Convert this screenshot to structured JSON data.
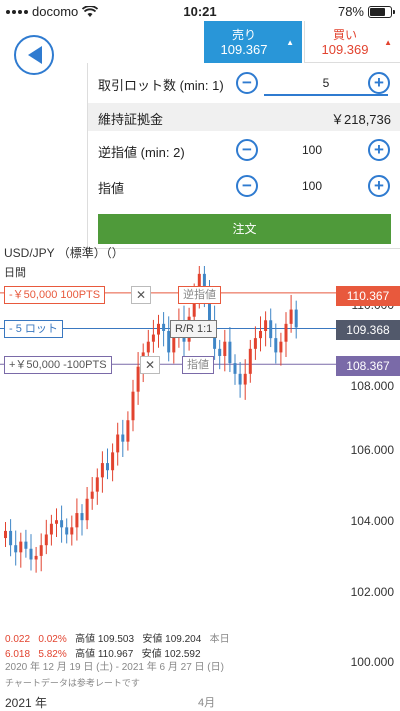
{
  "status_bar": {
    "carrier": "docomo",
    "time": "10:21",
    "battery": "78%"
  },
  "sell": {
    "label": "売り",
    "price": "109.367"
  },
  "buy": {
    "label": "買い",
    "price": "109.369"
  },
  "order_panel": {
    "lot_label": "取引ロット数 (min: 1)",
    "lot_value": "5",
    "margin_label": "維持証拠金",
    "margin_value": "￥218,736",
    "stop_label": "逆指値 (min: 2)",
    "stop_value": "100",
    "limit_label": "指値",
    "limit_value": "100",
    "order_button": "注文",
    "minus": "−",
    "plus": "+"
  },
  "chart": {
    "symbol": "USD/JPY （標準）（）",
    "timeframe": "日間",
    "stop_line": {
      "tag": "-￥50,000 100PTS",
      "label": "逆指値",
      "price": "110.367"
    },
    "position_line": {
      "tag": "- 5 ロット",
      "rr": "R/R 1:1",
      "price": "109.368"
    },
    "limit_line": {
      "tag": "+￥50,000 -100PTS",
      "label": "指値",
      "price": "108.367"
    },
    "close_symbol": "✕",
    "y_labels": [
      "110.000",
      "108.000",
      "106.000",
      "104.000",
      "102.000",
      "100.000"
    ],
    "x_labels": [
      "2021 年",
      "4月"
    ],
    "colors": {
      "up": "#e2432f",
      "down": "#3f86c6",
      "stop": "#e8593d",
      "position": "#3a78c0",
      "limit": "#7a6aa8"
    }
  },
  "chart_data": {
    "type": "candlestick",
    "title": "USD/JPY",
    "ylim": [
      100,
      111
    ],
    "candles_close": [
      103.7,
      103.3,
      103.1,
      103.4,
      103.2,
      102.9,
      103.0,
      103.3,
      103.6,
      103.9,
      104.0,
      103.8,
      103.6,
      103.8,
      104.2,
      104.0,
      104.6,
      104.8,
      105.2,
      105.6,
      105.4,
      105.9,
      106.4,
      106.2,
      106.8,
      107.6,
      108.3,
      108.7,
      109.0,
      109.2,
      109.5,
      109.3,
      108.7,
      109.2,
      109.6,
      109.0,
      109.7,
      110.3,
      110.9,
      110.4,
      109.6,
      108.8,
      108.6,
      109.0,
      108.4,
      108.1,
      107.8,
      108.1,
      108.8,
      109.1,
      109.3,
      109.6,
      109.1,
      108.7,
      109.0,
      109.5,
      109.9,
      109.4
    ]
  },
  "stats": {
    "change": "0.022",
    "change_pct": "0.02%",
    "high_label": "高値",
    "high": "109.503",
    "low_label": "安値",
    "low": "109.204",
    "today": "本日",
    "range_change": "6.018",
    "range_pct": "5.82%",
    "range_high": "110.967",
    "range_low": "102.592",
    "date_range": "2020 年 12 月 19 日 (土) - 2021 年 6 月 27 日 (日)",
    "note": "チャートデータは参考レートです"
  }
}
